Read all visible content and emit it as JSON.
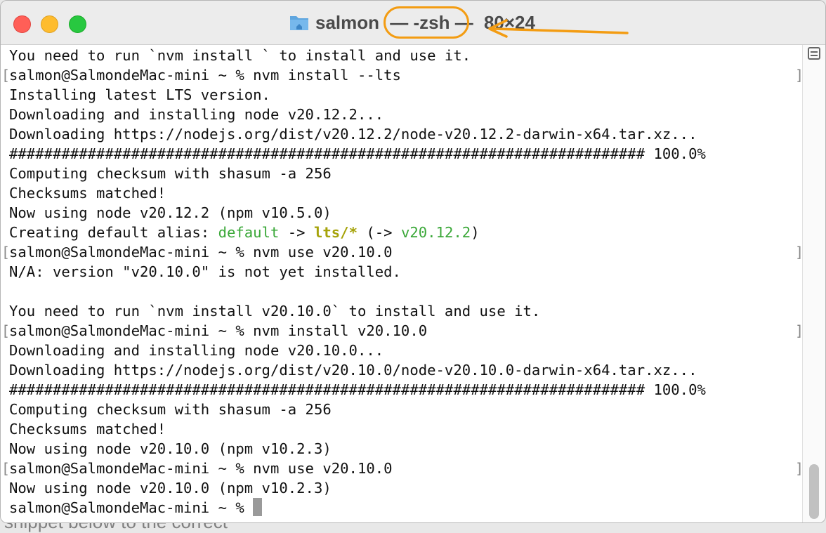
{
  "background_text": "snippet below to the correct",
  "window": {
    "title_name": "salmon",
    "title_shell": " — -zsh — ",
    "title_size": "80×24"
  },
  "colors": {
    "annotation": "#f39c12",
    "alias_green": "#3ba839",
    "alias_yellow": "#a6a30a"
  },
  "icons": {
    "folder": "folder-icon",
    "sidebar": "sidebar-toggle-icon"
  },
  "terminal": {
    "lines": [
      {
        "text": "You need to run `nvm install ` to install and use it.",
        "bracket": false
      },
      {
        "text": "salmon@SalmondeMac-mini ~ % nvm install --lts",
        "bracket": true
      },
      {
        "text": "Installing latest LTS version.",
        "bracket": false
      },
      {
        "text": "Downloading and installing node v20.12.2...",
        "bracket": false
      },
      {
        "text": "Downloading https://nodejs.org/dist/v20.12.2/node-v20.12.2-darwin-x64.tar.xz...",
        "bracket": false
      },
      {
        "text": "######################################################################### 100.0%",
        "bracket": false
      },
      {
        "text": "Computing checksum with shasum -a 256",
        "bracket": false
      },
      {
        "text": "Checksums matched!",
        "bracket": false
      },
      {
        "text": "Now using node v20.12.2 (npm v10.5.0)",
        "bracket": false
      },
      {
        "text": "ALIAS",
        "bracket": false
      },
      {
        "text": "salmon@SalmondeMac-mini ~ % nvm use v20.10.0",
        "bracket": true
      },
      {
        "text": "N/A: version \"v20.10.0\" is not yet installed.",
        "bracket": false
      },
      {
        "text": "",
        "bracket": false
      },
      {
        "text": "You need to run `nvm install v20.10.0` to install and use it.",
        "bracket": false
      },
      {
        "text": "salmon@SalmondeMac-mini ~ % nvm install v20.10.0",
        "bracket": true
      },
      {
        "text": "Downloading and installing node v20.10.0...",
        "bracket": false
      },
      {
        "text": "Downloading https://nodejs.org/dist/v20.10.0/node-v20.10.0-darwin-x64.tar.xz...",
        "bracket": false
      },
      {
        "text": "######################################################################### 100.0%",
        "bracket": false
      },
      {
        "text": "Computing checksum with shasum -a 256",
        "bracket": false
      },
      {
        "text": "Checksums matched!",
        "bracket": false
      },
      {
        "text": "Now using node v20.10.0 (npm v10.2.3)",
        "bracket": false
      },
      {
        "text": "salmon@SalmondeMac-mini ~ % nvm use v20.10.0",
        "bracket": true
      },
      {
        "text": "Now using node v20.10.0 (npm v10.2.3)",
        "bracket": false
      }
    ],
    "alias_line": {
      "prefix": "Creating default alias: ",
      "name": "default",
      "arrow": " -> ",
      "target": "lts/*",
      "open": " (-> ",
      "version": "v20.12.2",
      "close": ")"
    },
    "prompt": "salmon@SalmondeMac-mini ~ % "
  }
}
